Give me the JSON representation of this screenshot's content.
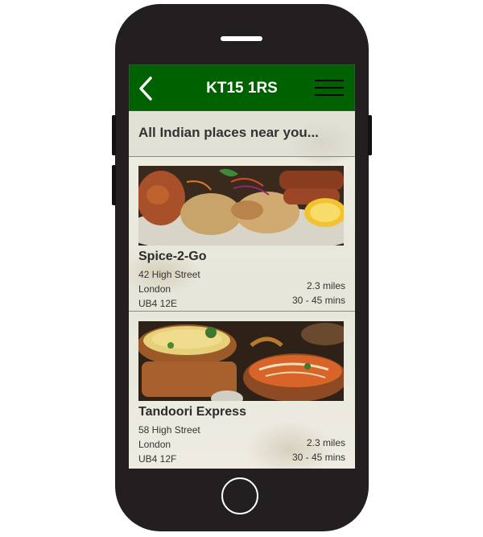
{
  "header": {
    "title": "KT15 1RS",
    "back_icon": "chevron-left-icon",
    "menu_icon": "hamburger-menu-icon"
  },
  "heading": "All Indian places near you...",
  "restaurants": [
    {
      "name": "Spice-2-Go",
      "address_line1": "42 High Street",
      "address_line2": "London",
      "postcode": "UB4 12E",
      "distance": "2.3 miles",
      "delivery_time": "30 - 45 mins"
    },
    {
      "name": "Tandoori Express",
      "address_line1": "58 High Street",
      "address_line2": "London",
      "postcode": "UB4 12F",
      "distance": "2.3 miles",
      "delivery_time": "30 - 45 mins"
    }
  ],
  "colors": {
    "header_bg": "#006100",
    "phone_body": "#231f20"
  }
}
